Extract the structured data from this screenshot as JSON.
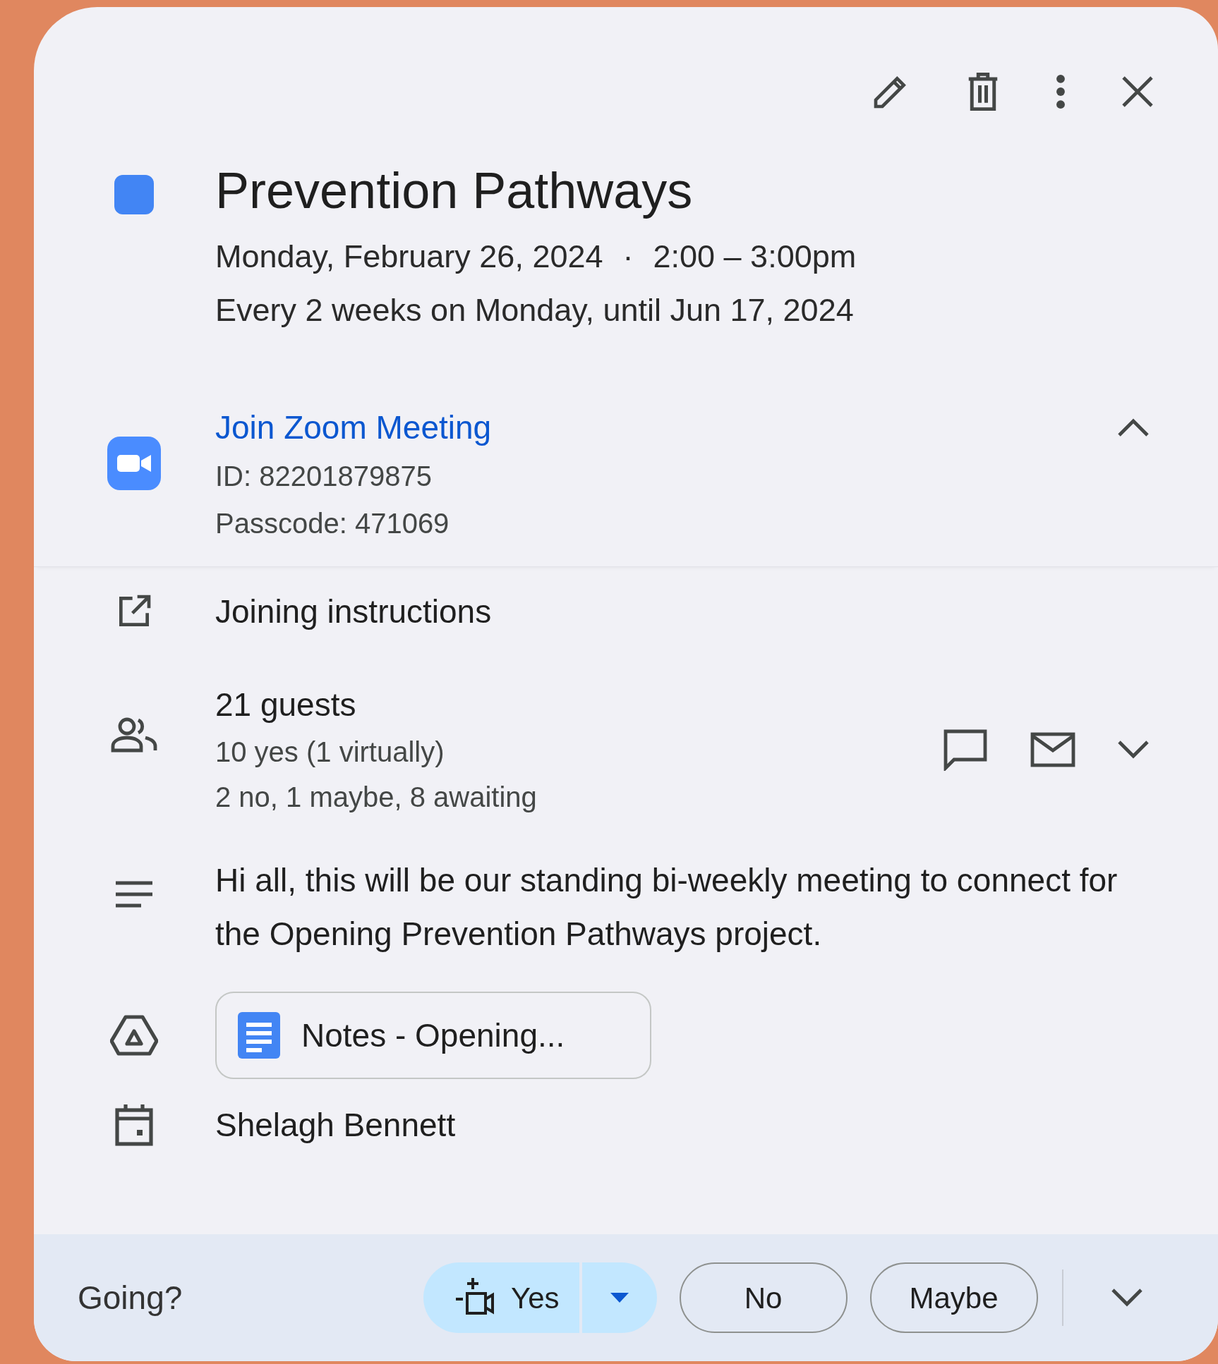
{
  "toolbar": {
    "actions": [
      {
        "kind": "edit"
      },
      {
        "kind": "delete"
      },
      {
        "kind": "more"
      },
      {
        "kind": "close"
      }
    ]
  },
  "event": {
    "title": "Prevention Pathways",
    "date": "Monday, February 26, 2024",
    "separator": "·",
    "time": "2:00 – 3:00pm",
    "recurrence": "Every 2 weeks on Monday, until Jun 17, 2024"
  },
  "conference": {
    "link": "Join Zoom Meeting",
    "id": "ID: 82201879875",
    "passcode": "Passcode: 471069",
    "expanded": true
  },
  "joining_instructions": "Joining instructions",
  "guests": {
    "count": "21 guests",
    "yes": "10 yes (1 virtually)",
    "others": "2 no, 1 maybe, 8 awaiting",
    "expanded": false
  },
  "description": "Hi all, this will be our standing bi-weekly meeting to connect for the Opening Prevention Pathways project.",
  "attachment": {
    "label": "Notes - Opening..."
  },
  "organizer": "Shelagh Bennett",
  "rsvp": {
    "prompt": "Going?",
    "options": [
      {
        "label": "Yes",
        "kind": "split",
        "selected": true
      },
      {
        "label": "No",
        "kind": "plain",
        "selected": false
      },
      {
        "label": "Maybe",
        "kind": "plain",
        "selected": false
      }
    ]
  }
}
